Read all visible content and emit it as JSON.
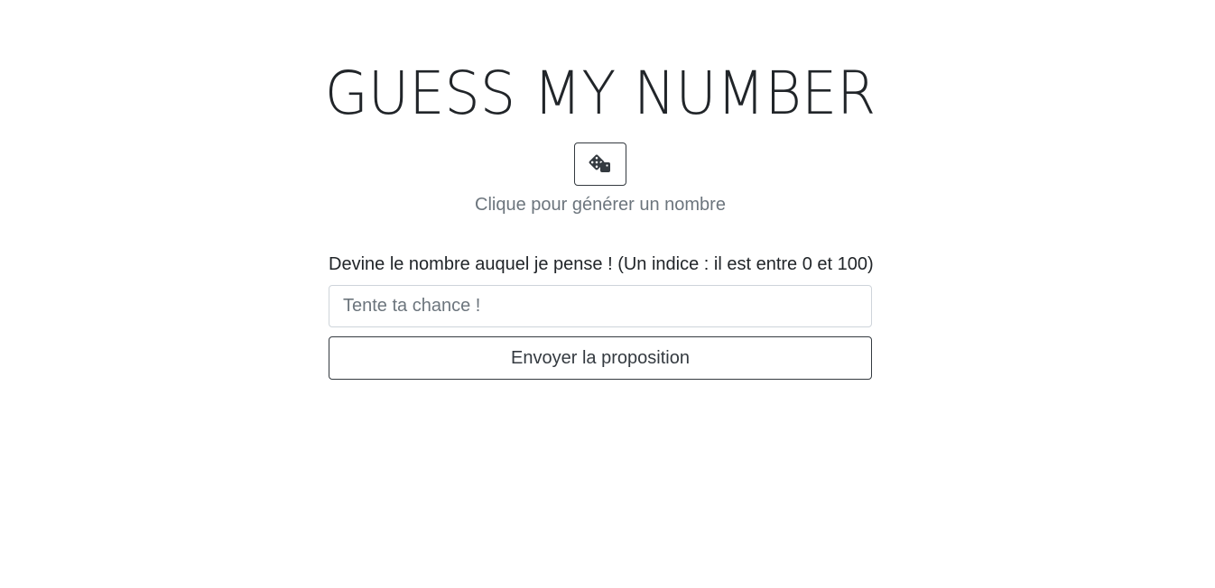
{
  "header": {
    "title": "GUESS MY NUMBER",
    "generate_icon": "dice-icon",
    "generate_hint": "Clique pour générer un nombre"
  },
  "form": {
    "label": "Devine le nombre auquel je pense ! (Un indice : il est entre 0 et 100)",
    "input_value": "",
    "input_placeholder": "Tente ta chance !",
    "submit_label": "Envoyer la proposition"
  },
  "colors": {
    "text": "#212529",
    "muted": "#6c757d",
    "button_border": "#343a40",
    "input_border": "#ced4da",
    "background": "#ffffff"
  }
}
